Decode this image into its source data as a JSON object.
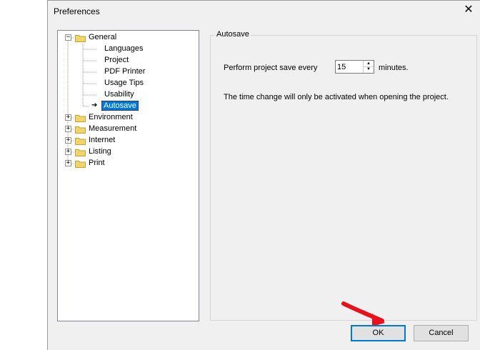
{
  "dialog": {
    "title": "Preferences",
    "close_symbol": "✕"
  },
  "tree": {
    "nodes": [
      {
        "label": "General",
        "expander": "−"
      },
      {
        "label": "Languages"
      },
      {
        "label": "Project"
      },
      {
        "label": "PDF Printer"
      },
      {
        "label": "Usage Tips"
      },
      {
        "label": "Usability"
      },
      {
        "label": "Autosave",
        "selected": true
      },
      {
        "label": "Environment",
        "expander": "+"
      },
      {
        "label": "Measurement",
        "expander": "+"
      },
      {
        "label": "Internet",
        "expander": "+"
      },
      {
        "label": "Listing",
        "expander": "+"
      },
      {
        "label": "Print",
        "expander": "+"
      }
    ]
  },
  "panel": {
    "group_title": "Autosave",
    "save_label": "Perform project save every",
    "save_value": "15",
    "unit": "minutes.",
    "info": "The time change will only be activated when opening the project."
  },
  "buttons": {
    "ok": "OK",
    "cancel": "Cancel"
  },
  "colors": {
    "selection": "#0078d7",
    "pointer": "#e8101a",
    "folder": "#f3d46b"
  },
  "icons": {
    "folder": "folder-icon",
    "pointer": "red-arrow-icon",
    "current": "arrow-right-icon"
  }
}
